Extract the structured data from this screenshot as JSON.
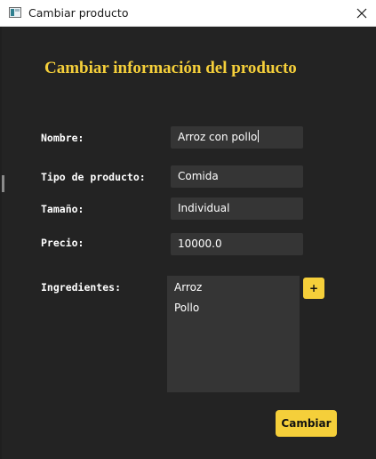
{
  "window": {
    "title": "Cambiar producto",
    "icon": "app-window-icon",
    "close_icon": "close-icon"
  },
  "form": {
    "heading": "Cambiar información del producto",
    "fields": {
      "nombre": {
        "label": "Nombre:",
        "value": "Arroz con pollo"
      },
      "tipo": {
        "label": "Tipo de producto:",
        "value": "Comida"
      },
      "tamano": {
        "label": "Tamaño:",
        "value": "Individual"
      },
      "precio": {
        "label": "Precio:",
        "value": "10000.0"
      }
    },
    "ingredientes": {
      "label": "Ingredientes:",
      "items": [
        "Arroz",
        "Pollo"
      ],
      "add_label": "+"
    },
    "submit_label": "Cambiar"
  },
  "colors": {
    "accent": "#f5cf3a",
    "background": "#232323",
    "field_bg": "#353535",
    "text": "#ffffff"
  }
}
